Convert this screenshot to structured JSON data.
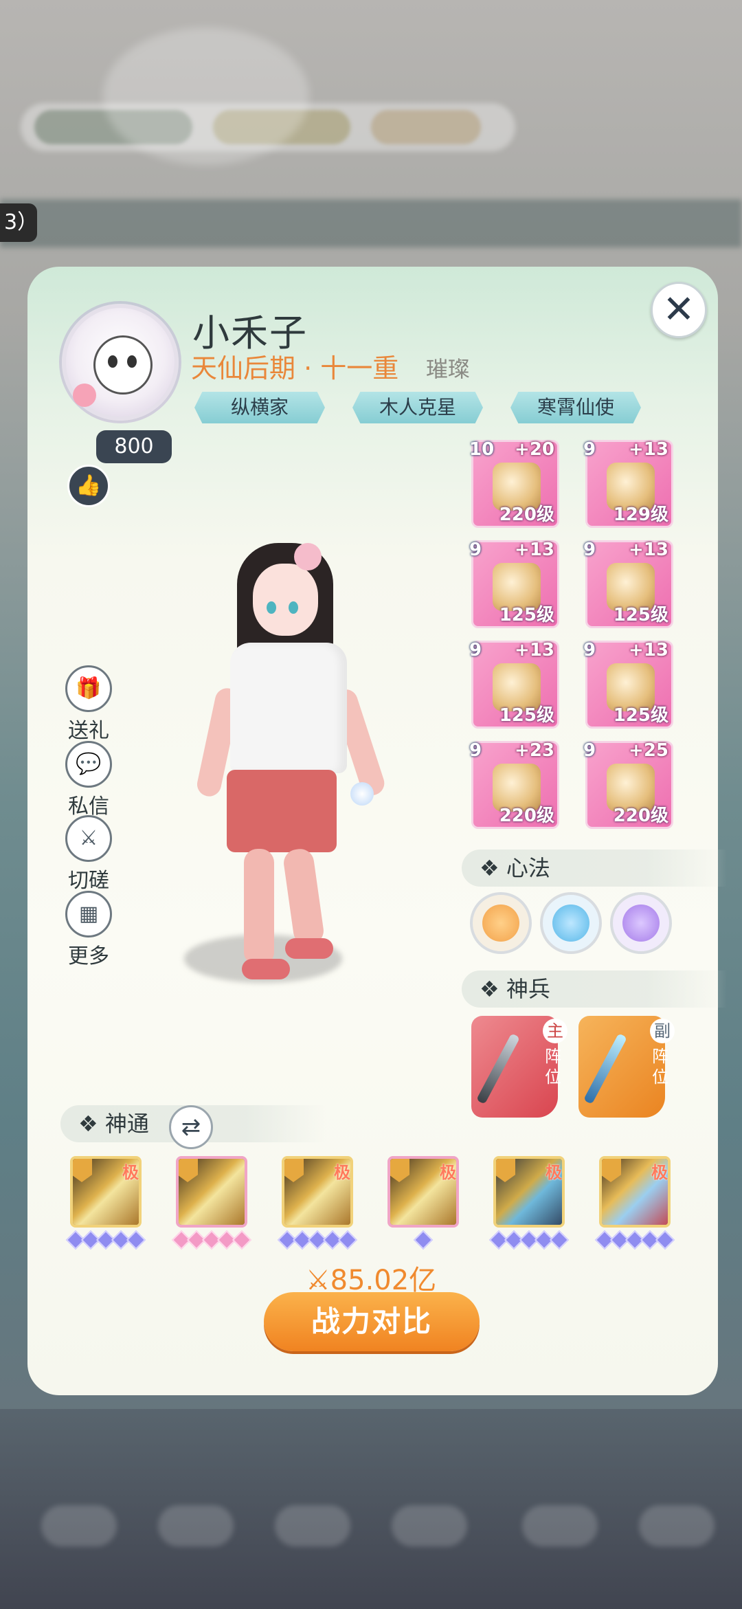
{
  "background": {
    "badge_text": "3）"
  },
  "profile": {
    "name": "小禾子",
    "realm": "天仙后期 · 十一重",
    "rank": "璀璨",
    "titles": [
      "纵横家",
      "木人克星",
      "寒霄仙使"
    ],
    "likes": "800"
  },
  "side_actions": [
    {
      "label": "送礼",
      "icon": "gift-icon"
    },
    {
      "label": "私信",
      "icon": "message-icon"
    },
    {
      "label": "切磋",
      "icon": "crossed-swords-icon"
    },
    {
      "label": "更多",
      "icon": "more-grid-icon"
    }
  ],
  "equipment": [
    {
      "star": "10",
      "plus": "+20",
      "level": "220级"
    },
    {
      "star": "9",
      "plus": "+13",
      "level": "129级"
    },
    {
      "star": "9",
      "plus": "+13",
      "level": "125级"
    },
    {
      "star": "9",
      "plus": "+13",
      "level": "125级"
    },
    {
      "star": "9",
      "plus": "+13",
      "level": "125级"
    },
    {
      "star": "9",
      "plus": "+13",
      "level": "125级"
    },
    {
      "star": "9",
      "plus": "+23",
      "level": "220级"
    },
    {
      "star": "9",
      "plus": "+25",
      "level": "220级"
    }
  ],
  "sections": {
    "xinfa": "心法",
    "shenbing": "神兵",
    "shentong": "神通"
  },
  "xinfa_colors": [
    "#f3a24a",
    "#56b7e8",
    "#a57be9"
  ],
  "shenbing": [
    {
      "tag": "主",
      "pos": "阵位",
      "color": "#e05a63"
    },
    {
      "tag": "副",
      "pos": "阵位",
      "color": "#f2972f"
    }
  ],
  "shentong": [
    {
      "badge": "极"
    },
    {
      "badge": ""
    },
    {
      "badge": "极"
    },
    {
      "badge": "极"
    },
    {
      "badge": "极"
    },
    {
      "badge": "极"
    }
  ],
  "power": "85.02亿",
  "compare_button": "战力对比",
  "colors": {
    "accent_orange": "#f08a2f",
    "equip_pink": "#f27bb9",
    "panel_bg": "#fbfbf4"
  }
}
